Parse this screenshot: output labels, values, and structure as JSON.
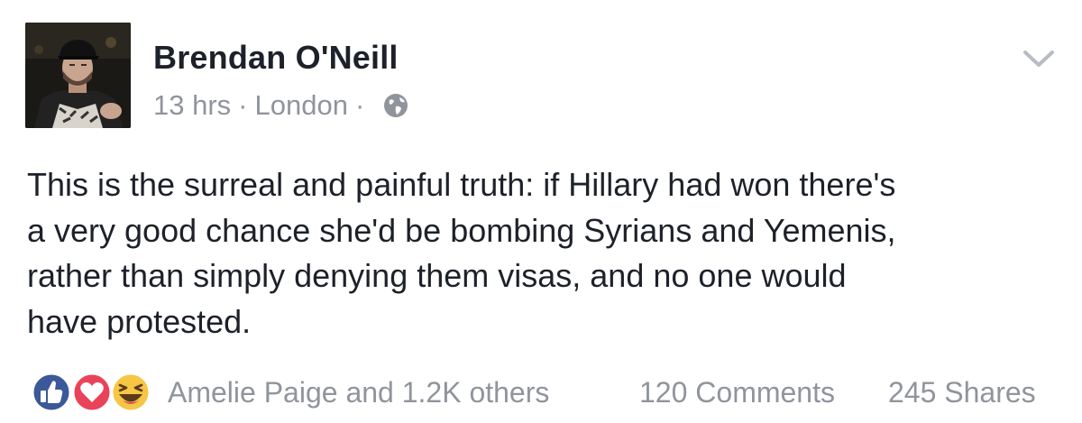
{
  "post": {
    "author": "Brendan O'Neill",
    "time": "13 hrs",
    "separator": "·",
    "location": "London",
    "text_lines": [
      "This is the surreal and painful truth: if Hillary had won there's",
      "a very good chance she'd be bombing Syrians and Yemenis,",
      "rather than simply denying them visas, and no one would",
      "have protested."
    ],
    "privacy_icon": "globe-icon",
    "menu_icon": "chevron-down-icon"
  },
  "footer": {
    "reactions": [
      "like-icon",
      "love-icon",
      "haha-icon"
    ],
    "reactors": "Amelie Paige and 1.2K others",
    "comments": "120 Comments",
    "shares": "245 Shares"
  },
  "colors": {
    "name": "#1d2129",
    "meta": "#90949c",
    "like": "#3b5998",
    "love": "#e9435a",
    "haha": "#f6c644"
  }
}
